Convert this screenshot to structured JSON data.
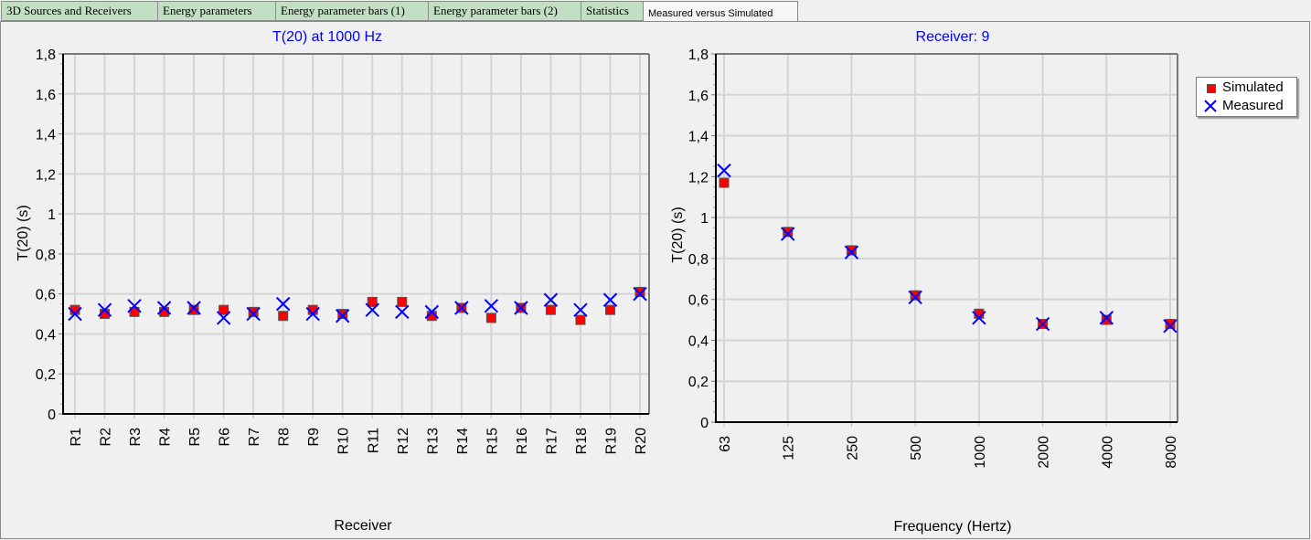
{
  "tabs": [
    {
      "label": "3D Sources and Receivers",
      "active": false
    },
    {
      "label": "Energy parameters",
      "active": false
    },
    {
      "label": "Energy parameter bars (1)",
      "active": false
    },
    {
      "label": "Energy parameter bars (2)",
      "active": false
    },
    {
      "label": "Statistics",
      "active": false
    },
    {
      "label": "Measured versus Simulated",
      "active": true
    }
  ],
  "colors": {
    "simulated": "#ff0000",
    "measured": "#0000ff",
    "title": "#0000ff",
    "grid": "#d4d4d4"
  },
  "legend": {
    "simulated_label": "Simulated",
    "measured_label": "Measured"
  },
  "chart_data": [
    {
      "type": "scatter",
      "title": "T(20) at 1000 Hz",
      "xlabel": "Receiver",
      "ylabel": "T(20) (s)",
      "ylim": [
        0,
        1.8
      ],
      "yticks": [
        "0",
        "0,2",
        "0,4",
        "0,6",
        "0,8",
        "1",
        "1,2",
        "1,4",
        "1,6",
        "1,8"
      ],
      "grid": true,
      "categories": [
        "R1",
        "R2",
        "R3",
        "R4",
        "R5",
        "R6",
        "R7",
        "R8",
        "R9",
        "R10",
        "R11",
        "R12",
        "R13",
        "R14",
        "R15",
        "R16",
        "R17",
        "R18",
        "R19",
        "R20"
      ],
      "series": [
        {
          "name": "Simulated",
          "marker": "square",
          "values": [
            0.52,
            0.5,
            0.51,
            0.51,
            0.52,
            0.52,
            0.51,
            0.49,
            0.52,
            0.5,
            0.56,
            0.56,
            0.49,
            0.53,
            0.48,
            0.53,
            0.52,
            0.47,
            0.52,
            0.61
          ]
        },
        {
          "name": "Measured",
          "marker": "x",
          "values": [
            0.5,
            0.52,
            0.54,
            0.53,
            0.53,
            0.48,
            0.5,
            0.55,
            0.5,
            0.49,
            0.52,
            0.51,
            0.51,
            0.53,
            0.54,
            0.53,
            0.57,
            0.52,
            0.57,
            0.6
          ]
        }
      ]
    },
    {
      "type": "scatter",
      "title": "Receiver: 9",
      "xlabel": "Frequency (Hertz)",
      "ylabel": "T(20) (s)",
      "ylim": [
        0,
        1.8
      ],
      "yticks": [
        "0",
        "0,2",
        "0,4",
        "0,6",
        "0,8",
        "1",
        "1,2",
        "1,4",
        "1,6",
        "1,8"
      ],
      "grid": true,
      "legend_position": "right",
      "categories": [
        "63",
        "125",
        "250",
        "500",
        "1000",
        "2000",
        "4000",
        "8000"
      ],
      "series": [
        {
          "name": "Simulated",
          "marker": "square",
          "values": [
            1.17,
            0.93,
            0.84,
            0.62,
            0.53,
            0.48,
            0.5,
            0.48
          ]
        },
        {
          "name": "Measured",
          "marker": "x",
          "values": [
            1.23,
            0.92,
            0.83,
            0.61,
            0.51,
            0.48,
            0.51,
            0.47
          ]
        }
      ]
    }
  ]
}
